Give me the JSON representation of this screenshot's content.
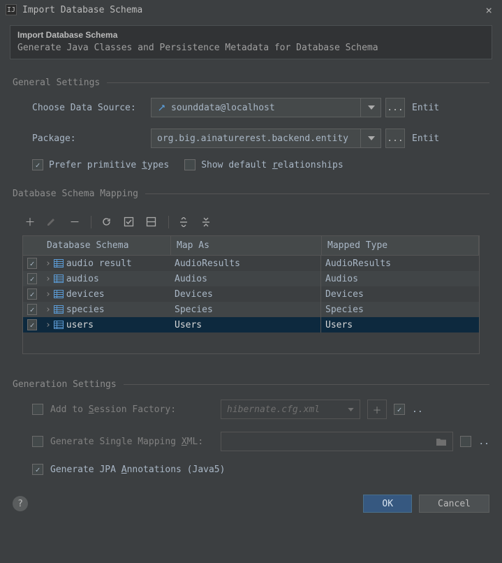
{
  "window": {
    "title": "Import Database Schema"
  },
  "banner": {
    "title": "Import Database Schema",
    "subtitle": "Generate Java Classes and Persistence Metadata for Database Schema"
  },
  "general": {
    "section_label": "General Settings",
    "datasource_label": "Choose Data Source:",
    "datasource_value": "sounddata@localhost",
    "datasource_trailing": "Entit",
    "package_label": "Package:",
    "package_value": "org.big.ainaturerest.backend.entity",
    "package_trailing": "Entit",
    "prefer_primitive_prefix": "Prefer primitive ",
    "prefer_primitive_underline": "t",
    "prefer_primitive_suffix": "ypes",
    "show_rel_prefix": "Show default ",
    "show_rel_underline": "r",
    "show_rel_suffix": "elationships"
  },
  "mapping": {
    "section_label": "Database Schema Mapping",
    "columns": {
      "schema": "Database Schema",
      "mapas": "Map As",
      "type": "Mapped Type"
    },
    "rows": [
      {
        "schema": "audio result",
        "mapas": "AudioResults",
        "type": "AudioResults"
      },
      {
        "schema": "audios",
        "mapas": "Audios",
        "type": "Audios"
      },
      {
        "schema": "devices",
        "mapas": "Devices",
        "type": "Devices"
      },
      {
        "schema": "species",
        "mapas": "Species",
        "type": "Species"
      },
      {
        "schema": "users",
        "mapas": "Users",
        "type": "Users"
      }
    ]
  },
  "generation": {
    "section_label": "Generation Settings",
    "session_prefix": "Add to ",
    "session_underline": "S",
    "session_suffix": "ession Factory:",
    "session_hint": "hibernate.cfg.xml",
    "session_trailing": "..",
    "single_prefix": "Generate Single Mapping ",
    "single_underline": "X",
    "single_suffix": "ML:",
    "single_trailing": "..",
    "jpa_prefix": "Generate JPA ",
    "jpa_underline": "A",
    "jpa_suffix": "nnotations (Java5)"
  },
  "footer": {
    "ok": "OK",
    "cancel": "Cancel"
  }
}
